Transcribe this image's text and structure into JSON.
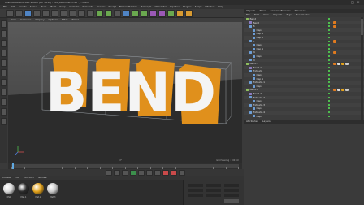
{
  "window": {
    "title": "CINEMA 4D R18.048 Studio (RC - R18) - [02_Deformers.c4d *] - Main",
    "minimize": "–",
    "maximize": "□",
    "close": "×"
  },
  "menubar": [
    "File",
    "Edit",
    "Create",
    "Select",
    "Tools",
    "Mesh",
    "Snap",
    "Animate",
    "Simulate",
    "Render",
    "Sculpt",
    "Motion Tracker",
    "MoGraph",
    "Character",
    "Pipeline",
    "Plugins",
    "Script",
    "Window",
    "Help"
  ],
  "viewport": {
    "menu": [
      "View",
      "Cameras",
      "Display",
      "Options",
      "Filter",
      "Panel"
    ],
    "text_3d": "BEND",
    "status": "Grid Spacing : 100 cm",
    "frame_readout": "0 F"
  },
  "timeline": {
    "frame": "0 F",
    "ticks": [
      "0",
      "5",
      "10",
      "15",
      "20",
      "25",
      "30",
      "35",
      "40",
      "45",
      "50",
      "55",
      "60",
      "65",
      "70",
      "75",
      "80",
      "85",
      "90"
    ]
  },
  "materials": {
    "menu": [
      "Create",
      "Edit",
      "Function",
      "Texture"
    ],
    "items": [
      {
        "name": "Mat",
        "color": "#d9d9d9"
      },
      {
        "name": "Mat.1",
        "color": "#2a2a2a"
      },
      {
        "name": "Mat.2",
        "color": "#e3a21a"
      },
      {
        "name": "Mat.3",
        "color": "#c9c9c9"
      }
    ]
  },
  "right_panel": {
    "tabs": [
      "Objects",
      "Takes",
      "Content Browser",
      "Structure"
    ],
    "objmgr_menu": [
      "File",
      "Edit",
      "View",
      "Objects",
      "Tags",
      "Bookmarks"
    ],
    "attr_tabs": [
      "Attributes",
      "Layers"
    ],
    "objects": [
      {
        "indent": 0,
        "label": "Bend",
        "icon": "#8fbf5f",
        "tags": []
      },
      {
        "indent": 1,
        "label": "Bend",
        "icon": "#8e7cc3",
        "tags": [
          "#e07a1f"
        ]
      },
      {
        "indent": 1,
        "label": "B",
        "icon": "#6d9ed6",
        "tags": [
          "#e07a1f"
        ]
      },
      {
        "indent": 2,
        "label": "Caps",
        "icon": "#6d9ed6",
        "tags": []
      },
      {
        "indent": 2,
        "label": "Cap 1",
        "icon": "#6d9ed6",
        "tags": []
      },
      {
        "indent": 2,
        "label": "Cap 2",
        "icon": "#6d9ed6",
        "tags": []
      },
      {
        "indent": 1,
        "label": "E",
        "icon": "#6d9ed6",
        "tags": [
          "#e07a1f"
        ]
      },
      {
        "indent": 2,
        "label": "Caps",
        "icon": "#6d9ed6",
        "tags": []
      },
      {
        "indent": 2,
        "label": "Cap 1",
        "icon": "#6d9ed6",
        "tags": []
      },
      {
        "indent": 1,
        "label": "N",
        "icon": "#6d9ed6",
        "tags": [
          "#e07a1f"
        ]
      },
      {
        "indent": 2,
        "label": "Caps",
        "icon": "#6d9ed6",
        "tags": []
      },
      {
        "indent": 1,
        "label": "D",
        "icon": "#6d9ed6",
        "tags": []
      },
      {
        "indent": 0,
        "label": "Bend.1",
        "icon": "#8fbf5f",
        "tags": [
          "#e07a1f",
          "#d9d9d9",
          "#e3a21a",
          "#c9c9c9"
        ]
      },
      {
        "indent": 1,
        "label": "Bend.1",
        "icon": "#8e7cc3",
        "tags": []
      },
      {
        "indent": 1,
        "label": "Extrude",
        "icon": "#6d9ed6",
        "tags": []
      },
      {
        "indent": 2,
        "label": "Caps",
        "icon": "#6d9ed6",
        "tags": []
      },
      {
        "indent": 2,
        "label": "Cap 1",
        "icon": "#6d9ed6",
        "tags": []
      },
      {
        "indent": 1,
        "label": "Extrude.1",
        "icon": "#6d9ed6",
        "tags": []
      },
      {
        "indent": 2,
        "label": "Caps",
        "icon": "#6d9ed6",
        "tags": []
      },
      {
        "indent": 0,
        "label": "Bend.2",
        "icon": "#8fbf5f",
        "tags": [
          "#e07a1f",
          "#d9d9d9",
          "#e3a21a",
          "#c9c9c9"
        ]
      },
      {
        "indent": 1,
        "label": "Bend.2",
        "icon": "#8e7cc3",
        "tags": []
      },
      {
        "indent": 1,
        "label": "Extrude.2",
        "icon": "#6d9ed6",
        "tags": []
      },
      {
        "indent": 2,
        "label": "Caps",
        "icon": "#6d9ed6",
        "tags": []
      },
      {
        "indent": 1,
        "label": "Extrude.3",
        "icon": "#6d9ed6",
        "tags": []
      },
      {
        "indent": 2,
        "label": "Caps",
        "icon": "#6d9ed6",
        "tags": []
      },
      {
        "indent": 1,
        "label": "Extrude.4",
        "icon": "#6d9ed6",
        "tags": []
      },
      {
        "indent": 2,
        "label": "Caps",
        "icon": "#6d9ed6",
        "tags": []
      }
    ]
  },
  "colors": {
    "accent": "#5fa8e0",
    "letter_face": "#f4f4f4",
    "letter_side": "#e0901c"
  }
}
